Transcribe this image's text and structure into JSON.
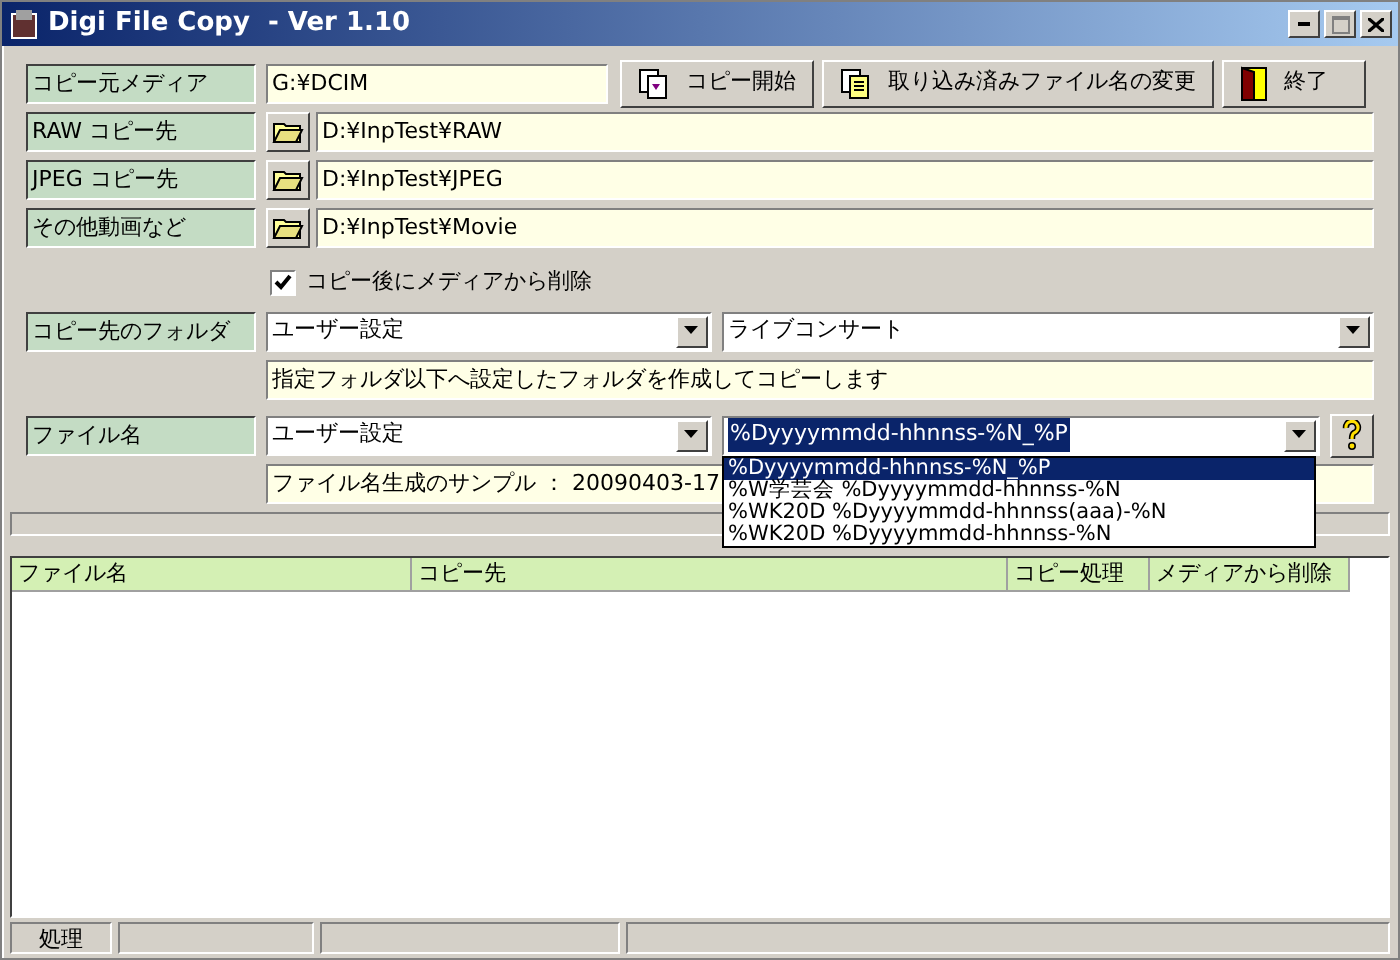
{
  "window": {
    "title": "Digi File Copy  - Ver 1.10"
  },
  "source": {
    "label": "コピー元メディア",
    "value": "G:¥DCIM"
  },
  "buttons": [
    {
      "kind": "copy",
      "label": "コピー開始"
    },
    {
      "kind": "rename",
      "label": "取り込み済みファイル名の変更"
    },
    {
      "kind": "exit",
      "label": "終了"
    }
  ],
  "destinations": [
    {
      "label": "RAW コピー先",
      "path": "D:¥InpTest¥RAW"
    },
    {
      "label": "JPEG コピー先",
      "path": "D:¥InpTest¥JPEG"
    },
    {
      "label": "その他動画など",
      "path": "D:¥InpTest¥Movie"
    }
  ],
  "delete_after_copy": {
    "label": "コピー後にメディアから削除",
    "checked": true
  },
  "folder": {
    "label": "コピー先のフォルダ",
    "mode": "ユーザー設定",
    "preset": "ライブコンサート",
    "description": "指定フォルダ以下へ設定したフォルダを作成してコピーします"
  },
  "filename": {
    "label": "ファイル名",
    "mode": "ユーザー設定",
    "pattern": "%Dyyyymmdd-hhnnss-%N_%P",
    "sample": "ファイル名生成のサンプル ： 20090403-17",
    "dropdown": [
      {
        "text": "%Dyyyymmdd-hhnnss-%N_%P",
        "selected": true
      },
      {
        "text": "%W学芸会 %Dyyyymmdd-hhnnss-%N",
        "selected": false
      },
      {
        "text": "%WK20D %Dyyyymmdd-hhnnss(aaa)-%N",
        "selected": false
      },
      {
        "text": "%WK20D %Dyyyymmdd-hhnnss-%N",
        "selected": false
      }
    ]
  },
  "table": {
    "columns": [
      "ファイル名",
      "コピー先",
      "コピー処理",
      "メディアから削除"
    ]
  },
  "status_bar": [
    "処理"
  ]
}
